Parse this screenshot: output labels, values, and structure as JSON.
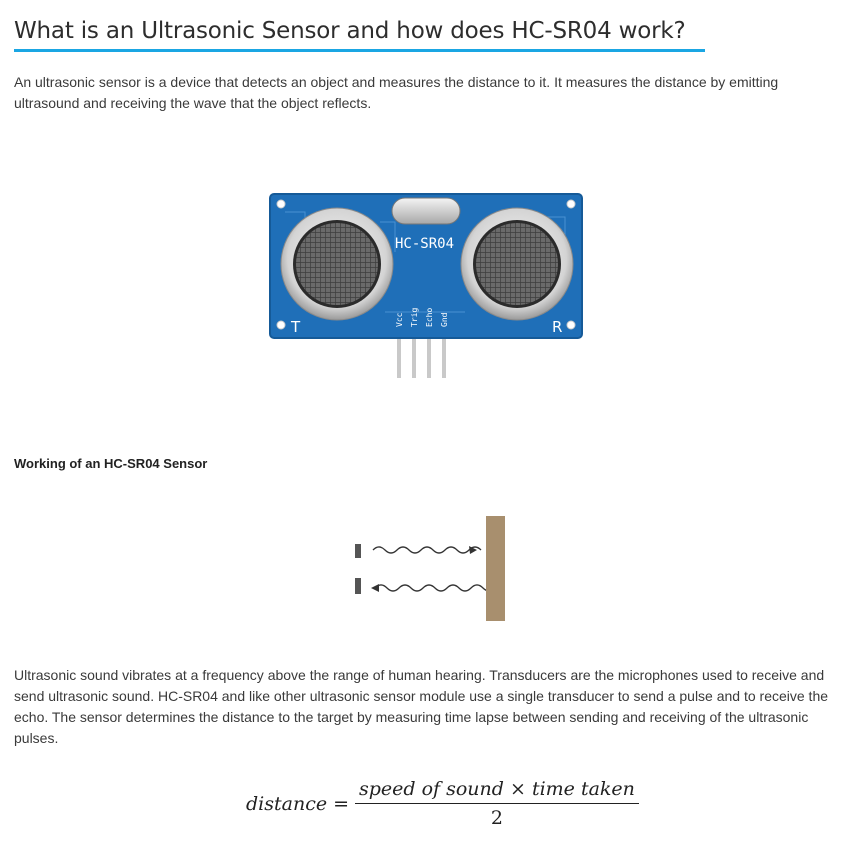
{
  "article": {
    "title": "What is an Ultrasonic Sensor and how does HC-SR04 work?",
    "intro": "An ultrasonic sensor is a device that detects an object and measures the distance to it. It measures the distance by emitting ultrasound and receiving the wave that the object reflects.",
    "sensor_image": {
      "board_label": "HC-SR04",
      "pins": [
        "Vcc",
        "Trig",
        "Echo",
        "Gnd"
      ],
      "left_marker": "T",
      "right_marker": "R"
    },
    "subheading": "Working of an HC-SR04 Sensor",
    "body": "Ultrasonic sound vibrates at a frequency above the range of human hearing. Transducers are the microphones used to receive and send ultrasonic sound. HC-SR04 and like other ultrasonic sensor module use a single transducer to send a pulse and to receive the echo. The sensor determines the distance to the target by measuring time lapse between sending and receiving of the ultrasonic pulses.",
    "formula": {
      "lhs": "distance",
      "equals": "=",
      "numerator": "speed of sound  × time taken",
      "denominator": "2"
    }
  },
  "colors": {
    "accent_underline": "#1aa6e3",
    "pcb_blue": "#1f6fb8",
    "target_wall": "#a88f6e"
  }
}
